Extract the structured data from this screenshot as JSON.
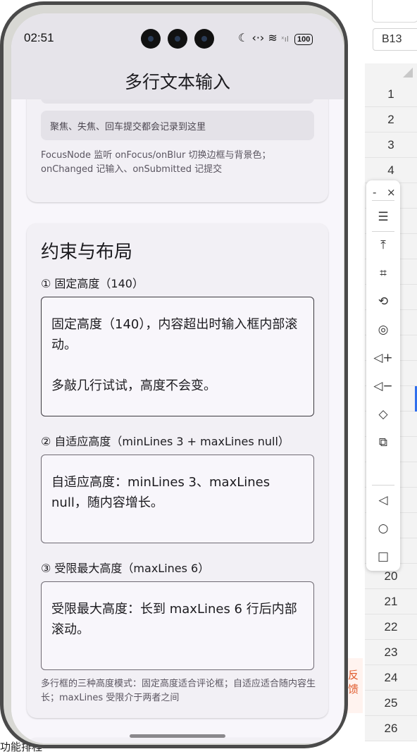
{
  "spreadsheet": {
    "cell_ref": "B13",
    "row_numbers": [
      "1",
      "2",
      "3",
      "4",
      "20",
      "21",
      "22",
      "23",
      "24",
      "25",
      "26"
    ],
    "side_badge": "反馈",
    "bottom_text": "功能排程"
  },
  "status_bar": {
    "time": "02:51",
    "battery": "100"
  },
  "app_bar": {
    "title": "多行文本输入"
  },
  "card_focus": {
    "log_text": "聚焦、失焦、回车提交都会记录到这里",
    "note": "FocusNode 监听 onFocus/onBlur 切换边框与背景色；onChanged 记输入、onSubmitted 记提交"
  },
  "card_layout": {
    "title": "约束与布局",
    "fixed": {
      "label": "① 固定高度（140）",
      "value": "固定高度（140），内容超出时输入框内部滚动。\n\n多敲几行试试，高度不会变。"
    },
    "adaptive": {
      "label": "② 自适应高度（minLines 3 + maxLines null）",
      "value": "自适应高度：minLines 3、maxLines null，随内容增长。"
    },
    "limited": {
      "label": "③ 受限最大高度（maxLines 6）",
      "value": "受限最大高度：长到 maxLines 6 行后内部滚动。"
    },
    "note": "多行框的三种高度模式：固定高度适合评论框；自适应适合随内容生长；maxLines 受限介于两者之间"
  },
  "toolbar": {
    "items": [
      "menu-icon",
      "pin-top-icon",
      "crop-icon",
      "rotate-icon",
      "screen-record-icon",
      "volume-up-icon",
      "volume-down-icon",
      "shake-icon",
      "screenshot-icon",
      "back-icon",
      "home-icon",
      "recents-icon"
    ]
  }
}
